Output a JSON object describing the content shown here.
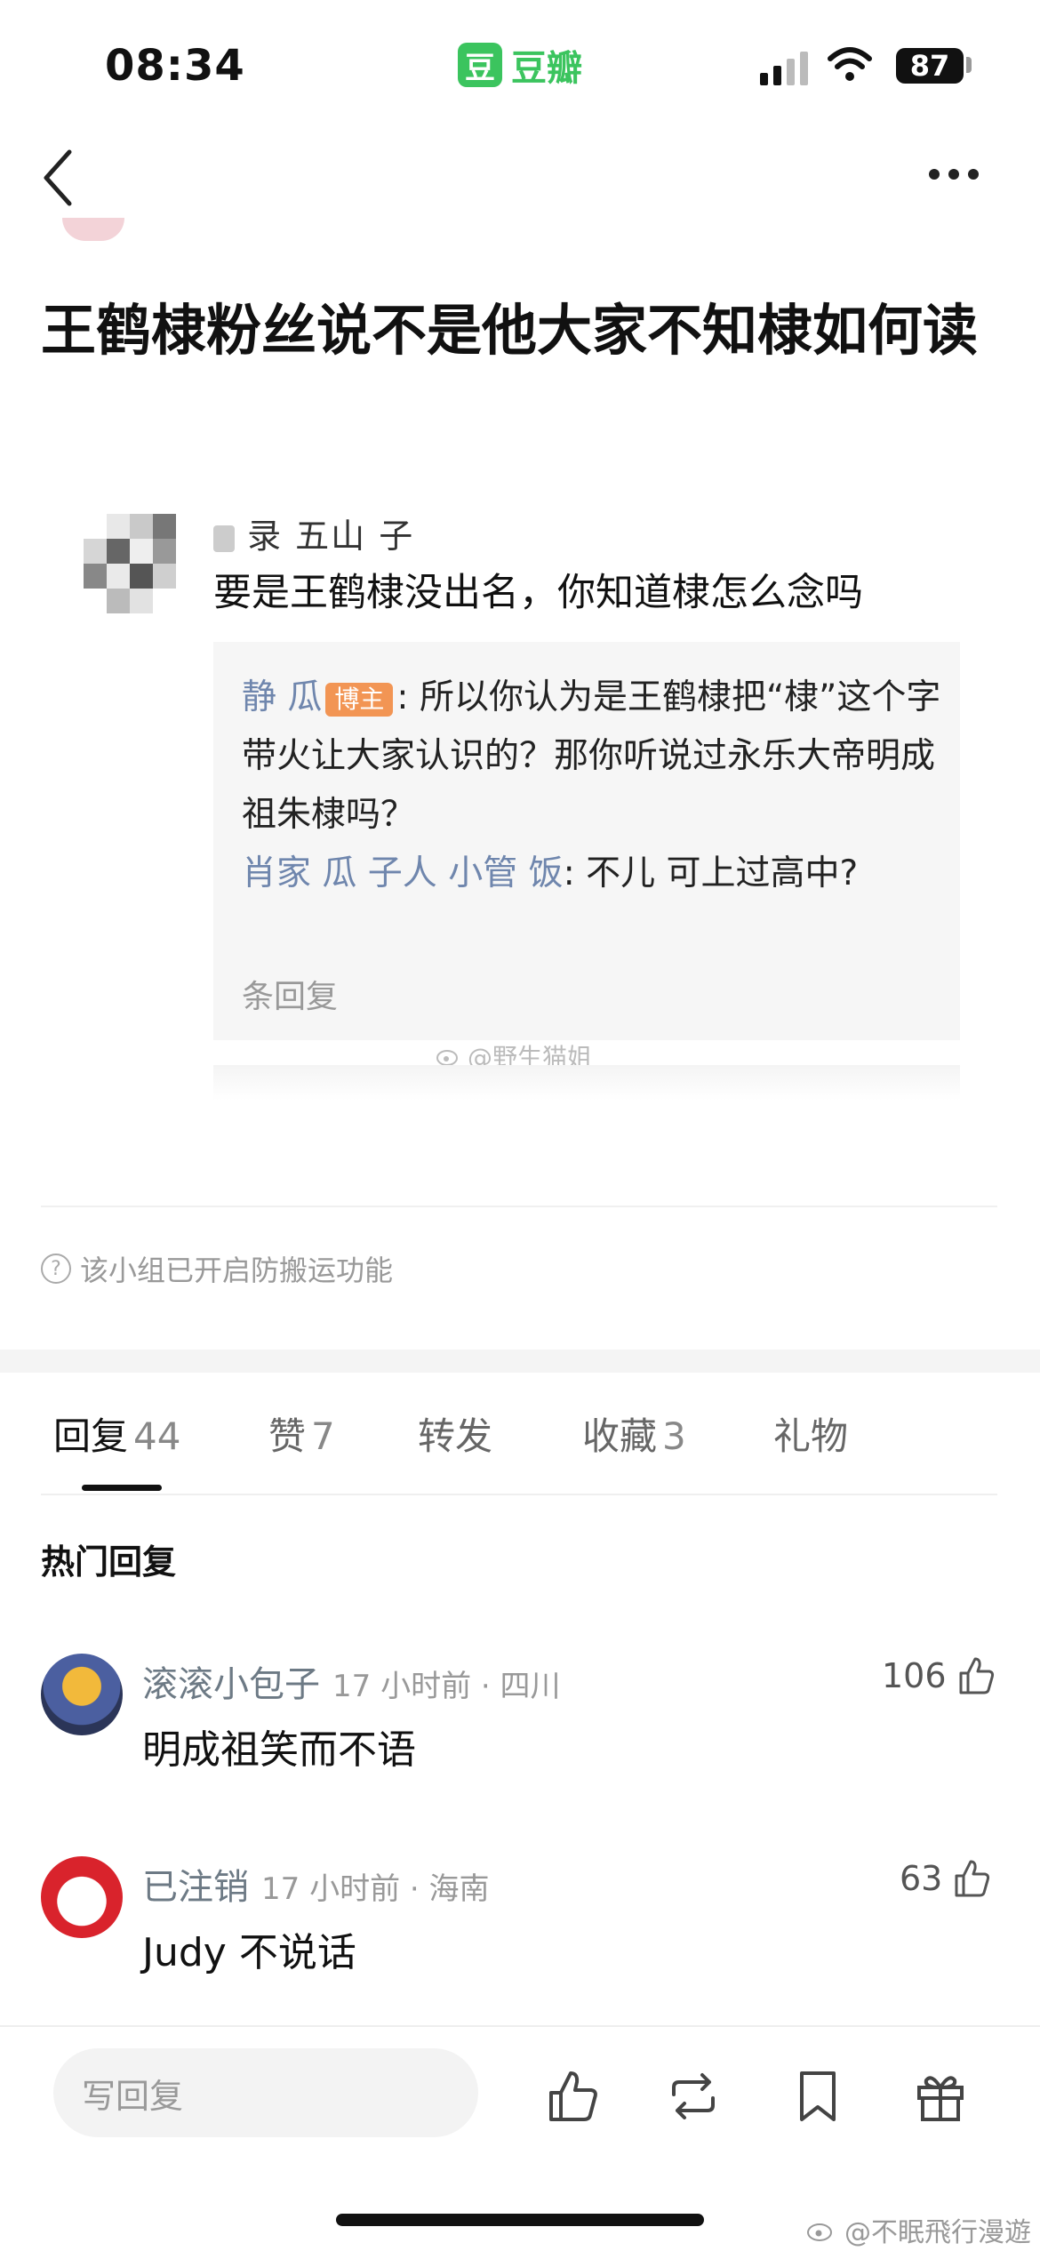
{
  "status_bar": {
    "time": "08:34",
    "app_logo_char": "豆",
    "app_name": "豆瓣",
    "battery": "87",
    "signal_icon": "signal-icon",
    "wifi_icon": "wifi-icon"
  },
  "nav": {
    "back_icon": "chevron-left-icon",
    "more_icon": "more-dots-icon"
  },
  "post": {
    "title": "王鹤棣粉丝说不是他大家不知棣如何读"
  },
  "embedded": {
    "name_visible": "录 五山    子",
    "comment": "要是王鹤棣没出名，你知道棣怎么念吗",
    "reply1_name": "静  瓜",
    "reply1_tag": "博主",
    "reply1_text": ": 所以你认为是王鹤棣把“棣”这个字带火让大家认识的？那你听说过永乐大帝明成祖朱棣吗？",
    "reply2_name": "肖家 瓜  子人 小管  饭",
    "reply2_text": ": 不儿 可上过高中?",
    "reply_count": "  条回复",
    "watermark": "@野生猫姐"
  },
  "notice": {
    "icon": "question-circle-icon",
    "text": "该小组已开启防搬运功能"
  },
  "tabs": [
    {
      "label": "回复",
      "count": "44",
      "active": true
    },
    {
      "label": "赞",
      "count": "7",
      "active": false
    },
    {
      "label": "转发",
      "count": "",
      "active": false
    },
    {
      "label": "收藏",
      "count": "3",
      "active": false
    },
    {
      "label": "礼物",
      "count": "",
      "active": false
    }
  ],
  "hot_replies_label": "热门回复",
  "comments": [
    {
      "name": "滚滚小包子",
      "meta": "17 小时前 · 四川",
      "text": "明成祖笑而不语",
      "likes": "106"
    },
    {
      "name": "已注销",
      "meta": "17 小时前 · 海南",
      "text": "Judy 不说话",
      "likes": "63"
    }
  ],
  "bottom_bar": {
    "reply_placeholder": "写回复",
    "icons": [
      "thumbs-up-icon",
      "repost-icon",
      "bookmark-icon",
      "gift-icon"
    ]
  },
  "watermark": "@不眠飛行漫遊",
  "colors": {
    "brand_green": "#3bc45e",
    "quote_name_blue": "#6f86ad",
    "blogger_tag": "#f29554"
  }
}
